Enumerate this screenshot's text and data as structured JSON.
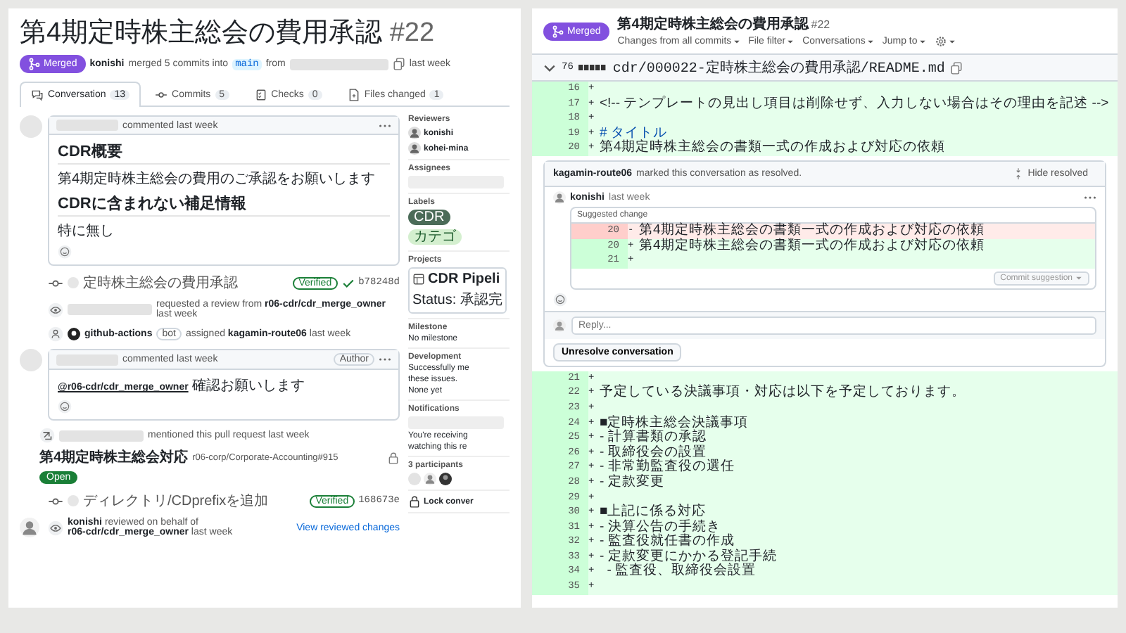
{
  "left": {
    "title": "第4期定時株主総会の費用承認",
    "number": "#22",
    "state": "Merged",
    "merge_info": {
      "author": "konishi",
      "text": "merged 5 commits into",
      "base": "main",
      "from": "from",
      "time": "last week"
    },
    "tabs": [
      {
        "label": "Conversation",
        "count": "13",
        "selected": true
      },
      {
        "label": "Commits",
        "count": "5",
        "selected": false
      },
      {
        "label": "Checks",
        "count": "0",
        "selected": false
      },
      {
        "label": "Files changed",
        "count": "1",
        "selected": false
      }
    ],
    "timeline": [
      {
        "kind": "comment",
        "meta": "commented last week",
        "blocks": [
          {
            "kind": "heading",
            "text": "CDR概要"
          },
          {
            "kind": "paragraph",
            "text": "第4期定時株主総会の費用のご承認をお願いします"
          },
          {
            "kind": "heading",
            "text": "CDRに含まれない補足情報"
          },
          {
            "kind": "paragraph",
            "text": "特に無し"
          }
        ]
      },
      {
        "kind": "commit",
        "message": "定時株主総会の費用承認",
        "verified": "Verified",
        "checked": true,
        "sha": "b78248d"
      },
      {
        "kind": "review_request",
        "text": "requested a review from **r06-cdr/cdr_merge_owner** last week"
      },
      {
        "kind": "assign",
        "actor": "github-actions",
        "actor_badge": "bot",
        "text": "assigned **kagamin-route06** last week"
      },
      {
        "kind": "comment",
        "meta": "commented last week",
        "badge": "Author",
        "blocks": [
          {
            "kind": "paragraph",
            "text": "**@r06-cdr/cdr_merge_owner** 確認お願いします"
          }
        ]
      },
      {
        "kind": "mention",
        "text": "mentioned this pull request last week",
        "ref_title": "第4期定時株主総会対応",
        "ref_repo": "r06-corp/Corporate-Accounting#915",
        "status": "Open"
      },
      {
        "kind": "commit",
        "message": "ディレクトリ/CDprefixを追加",
        "verified": "Verified",
        "checked": false,
        "sha": "168673e"
      },
      {
        "kind": "review",
        "text": "**konishi** reviewed on behalf of **r06-cdr/cdr_merge_owner** last week",
        "link": "View reviewed changes"
      }
    ],
    "sidebar": [
      {
        "heading": "Reviewers",
        "items": [
          {
            "kind": "user",
            "text": "konishi"
          },
          {
            "kind": "user",
            "text": "kohei-mina"
          }
        ]
      },
      {
        "heading": "Assignees",
        "items": [
          {
            "kind": "blank"
          }
        ]
      },
      {
        "heading": "Labels",
        "items": [
          {
            "kind": "label",
            "text": "CDR",
            "color": "#4b6b58"
          },
          {
            "kind": "label",
            "text": "カテゴ",
            "color": "#d4efcf"
          }
        ]
      },
      {
        "heading": "Projects",
        "items": [
          {
            "kind": "project",
            "text": "CDR Pipeli",
            "status": "Status: 承認完"
          }
        ]
      },
      {
        "heading": "Milestone",
        "items": [
          {
            "kind": "text",
            "text": "No milestone"
          }
        ]
      },
      {
        "heading": "Development",
        "items": [
          {
            "kind": "text",
            "text": "Successfully me"
          },
          {
            "kind": "text",
            "text": "these issues."
          },
          {
            "kind": "text",
            "text": "None yet"
          }
        ]
      },
      {
        "heading": "Notifications",
        "items": [
          {
            "kind": "blank"
          },
          {
            "kind": "text",
            "text": "You're receiving"
          },
          {
            "kind": "text",
            "text": "watching this re"
          }
        ]
      },
      {
        "heading": "3 participants",
        "items": [
          {
            "kind": "avatars"
          }
        ]
      },
      {
        "items": [
          {
            "kind": "lock",
            "text": "Lock conver"
          }
        ]
      }
    ]
  },
  "right": {
    "state": "Merged",
    "title": "第4期定時株主総会の費用承認",
    "number": "#22",
    "toolbar": [
      "Changes from all commits",
      "File filter",
      "Conversations",
      "Jump to"
    ],
    "file": {
      "count": "76",
      "path": "cdr/000022-定時株主総会の費用承認/README.md"
    },
    "lines_top": [
      {
        "n": "16",
        "sign": "+",
        "kind": "add"
      },
      {
        "n": "17",
        "sign": "+",
        "kind": "add",
        "text": "<!-- テンプレートの見出し項目は削除せず、入力しない場合はその理由を記述 -->"
      },
      {
        "n": "18",
        "sign": "+",
        "kind": "add"
      },
      {
        "n": "19",
        "sign": "+",
        "kind": "heading",
        "text": "# タイトル"
      },
      {
        "n": "20",
        "sign": "+",
        "kind": "add",
        "text": "第4期定時株主総会の書類一式の作成および対応の依頼"
      }
    ],
    "conversation": {
      "resolver": "kagamin-route06",
      "resolved_text": "marked this conversation as resolved.",
      "hide": "Hide resolved",
      "author": "konishi",
      "time": "last week",
      "suggestion_title": "Suggested change",
      "suggestion": [
        {
          "n": "20",
          "sign": "-",
          "kind": "del",
          "text": "第4期定時株主総会の書類一式の作成および対応の依頼"
        },
        {
          "n": "20",
          "sign": "+",
          "kind": "add",
          "text": "第4期定時株主総会の書類一式の作成および対応の依頼"
        },
        {
          "n": "21",
          "sign": "+",
          "kind": "add"
        }
      ],
      "commit_button": "Commit suggestion",
      "reply_placeholder": "Reply...",
      "unresolve": "Unresolve conversation"
    },
    "lines_bottom": [
      {
        "n": "21",
        "sign": "+",
        "kind": "add"
      },
      {
        "n": "22",
        "sign": "+",
        "kind": "add",
        "text": "予定している決議事項・対応は以下を予定しております。"
      },
      {
        "n": "23",
        "sign": "+",
        "kind": "add"
      },
      {
        "n": "24",
        "sign": "+",
        "kind": "add",
        "text": "■定時株主総会決議事項"
      },
      {
        "n": "25",
        "sign": "+",
        "kind": "add",
        "text": "- 計算書類の承認"
      },
      {
        "n": "26",
        "sign": "+",
        "kind": "add",
        "text": "- 取締役会の設置"
      },
      {
        "n": "27",
        "sign": "+",
        "kind": "add",
        "text": "- 非常勤監査役の選任"
      },
      {
        "n": "28",
        "sign": "+",
        "kind": "add",
        "text": "- 定款変更"
      },
      {
        "n": "29",
        "sign": "+",
        "kind": "add"
      },
      {
        "n": "30",
        "sign": "+",
        "kind": "add",
        "text": "■上記に係る対応"
      },
      {
        "n": "31",
        "sign": "+",
        "kind": "add",
        "text": "- 決算公告の手続き"
      },
      {
        "n": "32",
        "sign": "+",
        "kind": "add",
        "text": "- 監査役就任書の作成"
      },
      {
        "n": "33",
        "sign": "+",
        "kind": "add",
        "text": "- 定款変更にかかる登記手続"
      },
      {
        "n": "34",
        "sign": "+",
        "kind": "add",
        "text": "  - 監査役、取締役会設置"
      },
      {
        "n": "35",
        "sign": "+",
        "kind": "add"
      }
    ]
  }
}
